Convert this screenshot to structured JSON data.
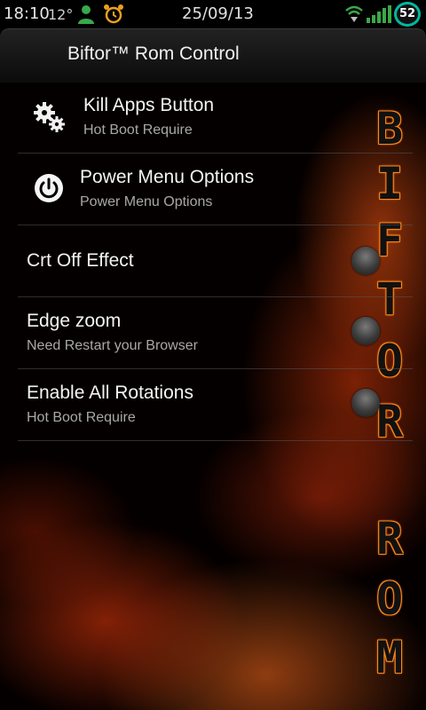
{
  "status_bar": {
    "time": "18:10",
    "temperature": "12°",
    "date": "25/09/13",
    "battery": "52",
    "icons": [
      "person-icon",
      "alarm-clock-icon",
      "wifi-icon",
      "signal-icon",
      "battery-icon"
    ]
  },
  "action_bar": {
    "title": "Biftor™ Rom Control"
  },
  "settings": [
    {
      "title": "Kill Apps Button",
      "subtitle": "Hot Boot Require",
      "icon": "gears-icon"
    },
    {
      "title": "Power Menu Options",
      "subtitle": "Power Menu Options",
      "icon": "power-icon"
    },
    {
      "title": "Crt Off Effect",
      "subtitle": "",
      "toggle": "off"
    },
    {
      "title": "Edge zoom",
      "subtitle": "Need Restart your Browser",
      "toggle": "off"
    },
    {
      "title": "Enable All Rotations",
      "subtitle": "Hot Boot Require",
      "toggle": "off"
    }
  ],
  "side_logo": {
    "text": "BIFTOR ROM",
    "color": "#ff8a1e"
  },
  "colors": {
    "accent": "#00b8a0",
    "status_green": "#3aa84a",
    "alarm_orange": "#e8a020"
  }
}
